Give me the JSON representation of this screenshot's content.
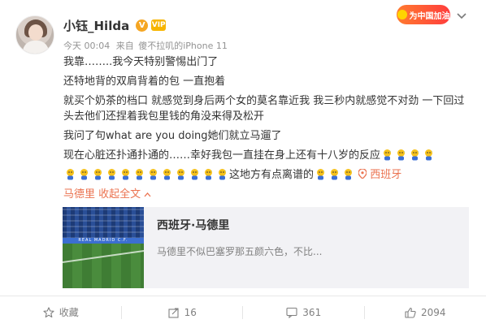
{
  "user": {
    "name": "小钰_Hilda",
    "verified_badge": "V",
    "vip_badge": "VIP"
  },
  "meta": {
    "time": "今天 00:04",
    "source_prefix": "来自",
    "source": "傻不拉叽的iPhone 11"
  },
  "promo": {
    "label": "为中国加油"
  },
  "post": {
    "line1": "我靠……..我今天特别警惕出门了",
    "line2": "还特地背的双肩背着的包 一直抱着",
    "line3": "就买个奶茶的档口 就感觉到身后两个女的莫名靠近我 我三秒内就感觉不对劲 一下回过头去他们还捏着我包里钱的角没来得及松开",
    "line4": "我问了句what are you doing她们就立马遛了",
    "line5": "现在心脏还扑通扑通的……幸好我包一直挂在身上还有十八岁的反应",
    "line6_text": "这地方有点离谱的",
    "location": "西班牙",
    "location2": "马德里",
    "expand": "收起全文"
  },
  "link_card": {
    "title": "西班牙·马德里",
    "description": "马德里不似巴塞罗那五颜六色，不比...",
    "thumb_banner": "REAL MADRID C.F."
  },
  "actions": {
    "favorite": "收藏",
    "share_count": "16",
    "comment_count": "361",
    "like_count": "2094"
  },
  "colors": {
    "accent": "#eb7350",
    "muted": "#808080"
  }
}
